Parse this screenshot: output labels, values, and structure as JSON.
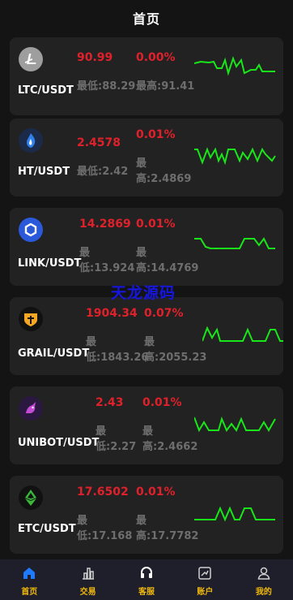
{
  "header": {
    "title": "首页"
  },
  "watermark": "天龙源码",
  "coins": [
    {
      "pair": "LTC/USDT",
      "price": "90.99",
      "change": "0.00%",
      "low_label": "最低:",
      "low": "88.29",
      "high_label": "最高:",
      "high": "91.41",
      "icon": "litecoin-icon"
    },
    {
      "pair": "HT/USDT",
      "price": "2.4578",
      "change": "0.01%",
      "low_label": "最低:",
      "low": "2.42",
      "high_label": "最高:",
      "high": "2.4869",
      "icon": "huobi-token-icon"
    },
    {
      "pair": "LINK/USDT",
      "price": "14.2869",
      "change": "0.01%",
      "low_label": "最低:",
      "low": "13.924",
      "high_label": "最高:",
      "high": "14.4769",
      "icon": "chainlink-icon"
    },
    {
      "pair": "GRAIL/USDT",
      "price": "1904.34",
      "change": "0.07%",
      "low_label": "最低:",
      "low": "1843.26",
      "high_label": "最高:",
      "high": "2055.23",
      "icon": "grail-icon"
    },
    {
      "pair": "UNIBOT/USDT",
      "price": "2.43",
      "change": "0.01%",
      "low_label": "最低:",
      "low": "2.27",
      "high_label": "最高:",
      "high": "2.4662",
      "icon": "unibot-icon"
    },
    {
      "pair": "ETC/USDT",
      "price": "17.6502",
      "change": "0.01%",
      "low_label": "最低:",
      "low": "17.168",
      "high_label": "最高:",
      "high": "17.7782",
      "icon": "ethereum-classic-icon"
    }
  ],
  "tabs": [
    {
      "label": "首页",
      "icon": "home-icon",
      "active": true
    },
    {
      "label": "交易",
      "icon": "chart-bars-icon"
    },
    {
      "label": "客服",
      "icon": "headset-icon"
    },
    {
      "label": "账户",
      "icon": "account-icon"
    },
    {
      "label": "我的",
      "icon": "profile-icon"
    }
  ],
  "colors": {
    "up_red": "#e0212b",
    "spark_green": "#19e619",
    "tab_label": "#f0b90b",
    "active_tab_icon": "#1e7bff"
  }
}
